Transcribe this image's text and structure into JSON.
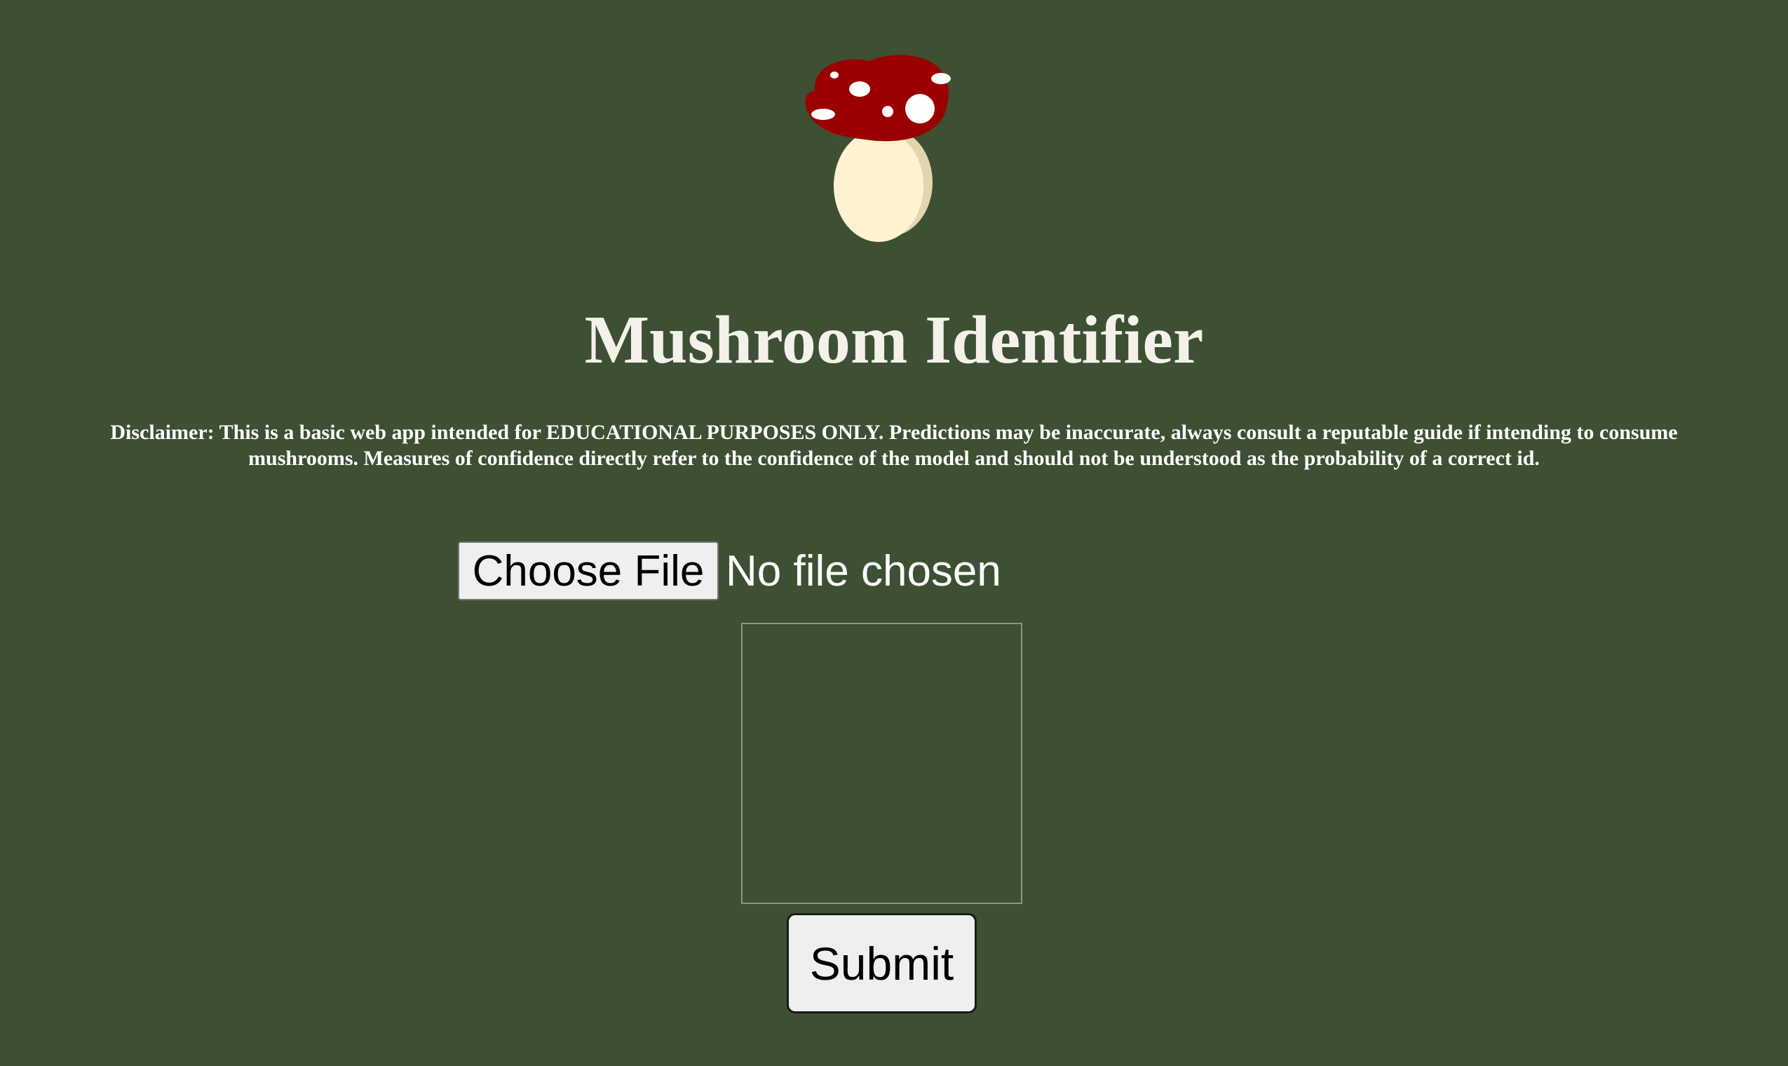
{
  "app": {
    "title": "Mushroom Identifier",
    "logo_icon": "mushroom-icon"
  },
  "disclaimer": {
    "text": "Disclaimer: This is a basic web app intended for EDUCATIONAL PURPOSES ONLY. Predictions may be inaccurate, always consult a reputable guide if intending to consume mushrooms. Measures of confidence directly refer to the confidence of the model and should not be understood as the probability of a correct id."
  },
  "upload": {
    "choose_file_label": "Choose File",
    "status_text": "No file chosen"
  },
  "form": {
    "submit_label": "Submit"
  },
  "colors": {
    "background": "#3d5033",
    "cap": "#9b0000",
    "stem": "#fff2d1",
    "text": "#ffffff"
  }
}
